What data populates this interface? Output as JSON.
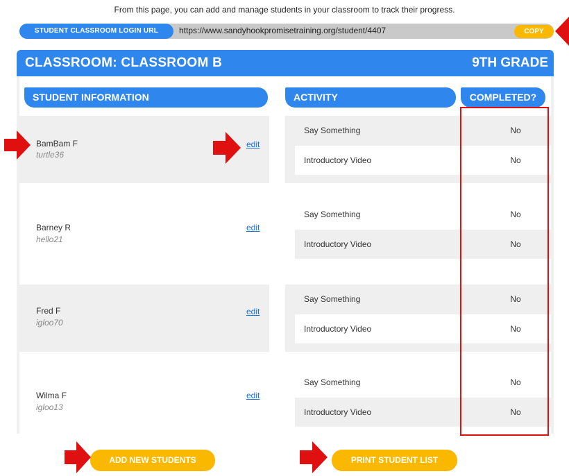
{
  "intro_text": "From this page, you can add and manage students in your classroom to track their progress.",
  "login_url": {
    "label": "STUDENT CLASSROOM LOGIN URL",
    "value": "https://www.sandyhookpromisetraining.org/student/4407",
    "copy_label": "COPY"
  },
  "classroom": {
    "title": "CLASSROOM: CLASSROOM B",
    "grade": "9TH GRADE"
  },
  "columns": {
    "student_info": "STUDENT INFORMATION",
    "activity": "ACTIVITY",
    "completed": "COMPLETED?"
  },
  "students": [
    {
      "name": "BamBam F",
      "username": "turtle36",
      "edit_label": "edit",
      "activities": [
        {
          "name": "Say Something",
          "completed": "No"
        },
        {
          "name": "Introductory Video",
          "completed": "No"
        }
      ]
    },
    {
      "name": "Barney R",
      "username": "hello21",
      "edit_label": "edit",
      "activities": [
        {
          "name": "Say Something",
          "completed": "No"
        },
        {
          "name": "Introductory Video",
          "completed": "No"
        }
      ]
    },
    {
      "name": "Fred F",
      "username": "igloo70",
      "edit_label": "edit",
      "activities": [
        {
          "name": "Say Something",
          "completed": "No"
        },
        {
          "name": "Introductory Video",
          "completed": "No"
        }
      ]
    },
    {
      "name": "Wilma F",
      "username": "igloo13",
      "edit_label": "edit",
      "activities": [
        {
          "name": "Say Something",
          "completed": "No"
        },
        {
          "name": "Introductory Video",
          "completed": "No"
        }
      ]
    }
  ],
  "buttons": {
    "add_students": "ADD NEW STUDENTS",
    "print_list": "PRINT STUDENT LIST"
  },
  "colors": {
    "accent_blue": "#2f86ec",
    "button_yellow": "#fbb800",
    "annotation_red": "#e01010",
    "row_gray": "#efefef"
  }
}
